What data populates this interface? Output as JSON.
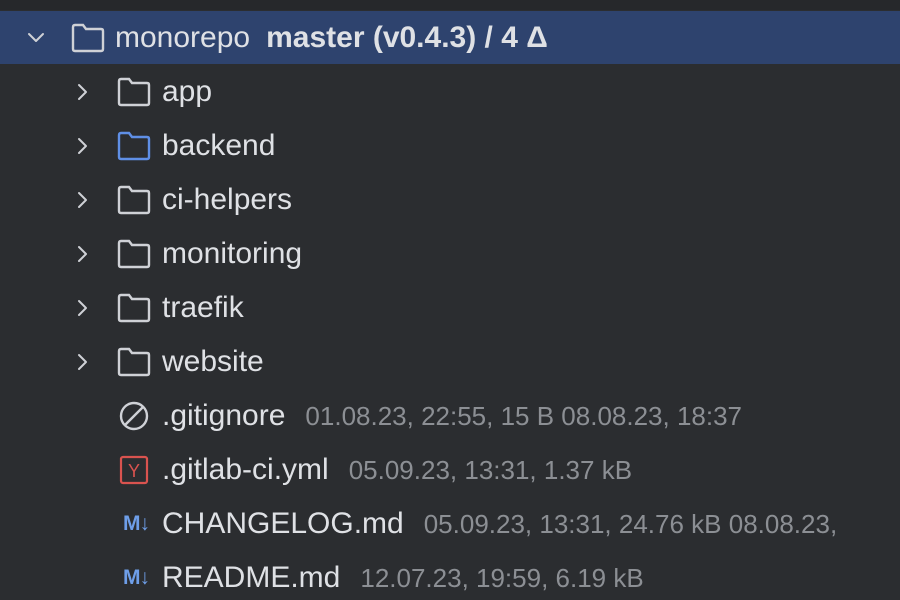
{
  "tree": {
    "root": {
      "name": "monorepo",
      "vcs": "master (v0.4.3) / 4 Δ",
      "expanded": true,
      "icon": "folder-icon"
    },
    "folders": [
      {
        "name": "app",
        "icon": "folder-icon",
        "color": "#cfd1d6"
      },
      {
        "name": "backend",
        "icon": "folder-icon",
        "color": "#5f8fe6"
      },
      {
        "name": "ci-helpers",
        "icon": "folder-icon",
        "color": "#cfd1d6"
      },
      {
        "name": "monitoring",
        "icon": "folder-icon",
        "color": "#cfd1d6"
      },
      {
        "name": "traefik",
        "icon": "folder-icon",
        "color": "#cfd1d6"
      },
      {
        "name": "website",
        "icon": "folder-icon",
        "color": "#cfd1d6"
      }
    ],
    "files": [
      {
        "name": ".gitignore",
        "meta": "01.08.23, 22:55, 15 B 08.08.23, 18:37",
        "icon": "ignore-icon"
      },
      {
        "name": ".gitlab-ci.yml",
        "meta": "05.09.23, 13:31, 1.37 kB",
        "icon": "yaml-icon",
        "badge": "Y"
      },
      {
        "name": "CHANGELOG.md",
        "meta": "05.09.23, 13:31, 24.76 kB 08.08.23,",
        "icon": "markdown-icon",
        "badge": "M↓"
      },
      {
        "name": "README.md",
        "meta": "12.07.23, 19:59, 6.19 kB",
        "icon": "markdown-icon",
        "badge": "M↓"
      }
    ]
  },
  "colors": {
    "background": "#2b2d30",
    "selection": "#2e436e",
    "text": "#dfe1e5",
    "meta": "#8c8f94",
    "yaml": "#d9534f",
    "markdown": "#6e9ee8"
  }
}
